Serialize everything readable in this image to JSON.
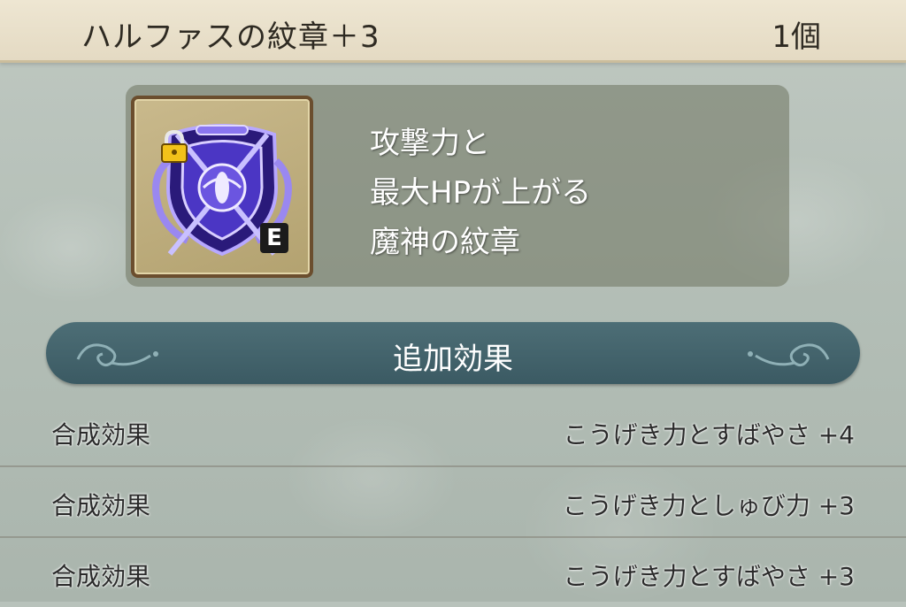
{
  "header": {
    "item_name": "ハルファスの紋章＋3",
    "item_count": "1個"
  },
  "item": {
    "icon": "crest-icon",
    "lock_icon": "lock-icon",
    "equipped_badge": "E",
    "description_lines": [
      "攻撃力と",
      "最大HPが上がる",
      "魔神の紋章"
    ]
  },
  "section": {
    "title": "追加効果"
  },
  "effects": [
    {
      "label": "合成効果",
      "value": "こうげき力とすばやさ +4"
    },
    {
      "label": "合成効果",
      "value": "こうげき力としゅび力 +3"
    },
    {
      "label": "合成効果",
      "value": "こうげき力とすばやさ +3"
    }
  ],
  "colors": {
    "header_bg": "#e8dfca",
    "section_bar": "#456670",
    "crest_purple": "#5a3fd0"
  }
}
